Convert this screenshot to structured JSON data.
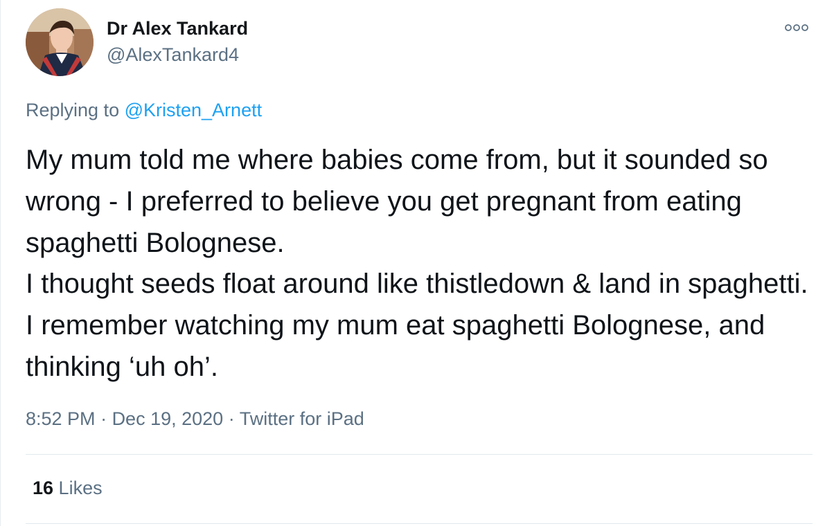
{
  "author": {
    "display_name": "Dr Alex Tankard",
    "handle": "@AlexTankard4",
    "avatar_icon": "profile-photo"
  },
  "more_icon": "more-options-icon",
  "reply": {
    "prefix": "Replying to ",
    "mention": "@Kristen_Arnett"
  },
  "tweet": {
    "text": "My mum told me where babies come from, but it sounded so wrong - I preferred to believe you get pregnant from eating spaghetti Bolognese.\nI thought seeds float around like thistledown & land in spaghetti. I remember watching my mum eat spaghetti Bolognese, and thinking ‘uh oh’."
  },
  "meta": {
    "time": "8:52 PM",
    "separator": " · ",
    "date": "Dec 19, 2020",
    "source": "Twitter for iPad"
  },
  "stats": {
    "likes_count": "16",
    "likes_label": " Likes"
  },
  "colors": {
    "link": "#1da1f2",
    "secondary_text": "#5b7083",
    "primary_text": "#0f1419",
    "divider": "#e1e8ed"
  }
}
